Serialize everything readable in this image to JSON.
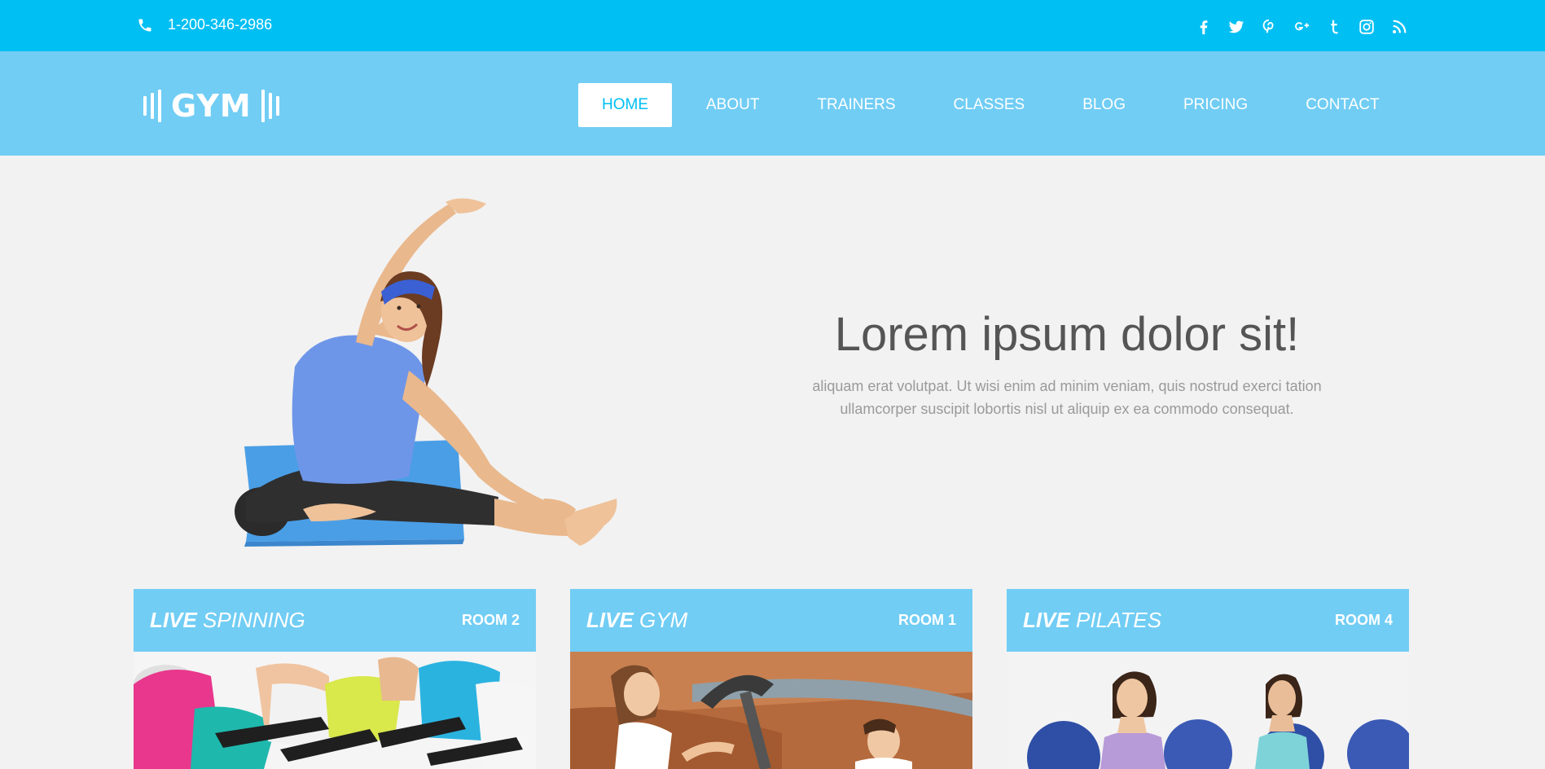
{
  "topbar": {
    "phone": "1-200-346-2986",
    "socials": [
      "facebook-icon",
      "twitter-icon",
      "pinterest-icon",
      "google-plus-icon",
      "tumblr-icon",
      "instagram-icon",
      "rss-icon"
    ]
  },
  "brand": {
    "logo_text": "GYM"
  },
  "nav": {
    "items": [
      {
        "label": "HOME",
        "active": true
      },
      {
        "label": "ABOUT"
      },
      {
        "label": "TRAINERS"
      },
      {
        "label": "CLASSES"
      },
      {
        "label": "BLOG"
      },
      {
        "label": "PRICING"
      },
      {
        "label": "CONTACT"
      }
    ]
  },
  "hero": {
    "title": "Lorem ipsum dolor sit!",
    "subtitle_line1": "aliquam erat volutpat. Ut wisi enim ad minim veniam, quis nostrud exerci tation",
    "subtitle_line2": "ullamcorper suscipit lobortis nisl ut aliquip ex ea commodo consequat."
  },
  "cards": [
    {
      "live": "LIVE",
      "name": "SPINNING",
      "room": "ROOM 2"
    },
    {
      "live": "LIVE",
      "name": "GYM",
      "room": "ROOM 1"
    },
    {
      "live": "LIVE",
      "name": "PILATES",
      "room": "ROOM 4"
    }
  ],
  "colors": {
    "topbar": "#00bff3",
    "navbar": "#71cdf4",
    "background": "#f2f2f2",
    "text_dark": "#555555"
  }
}
